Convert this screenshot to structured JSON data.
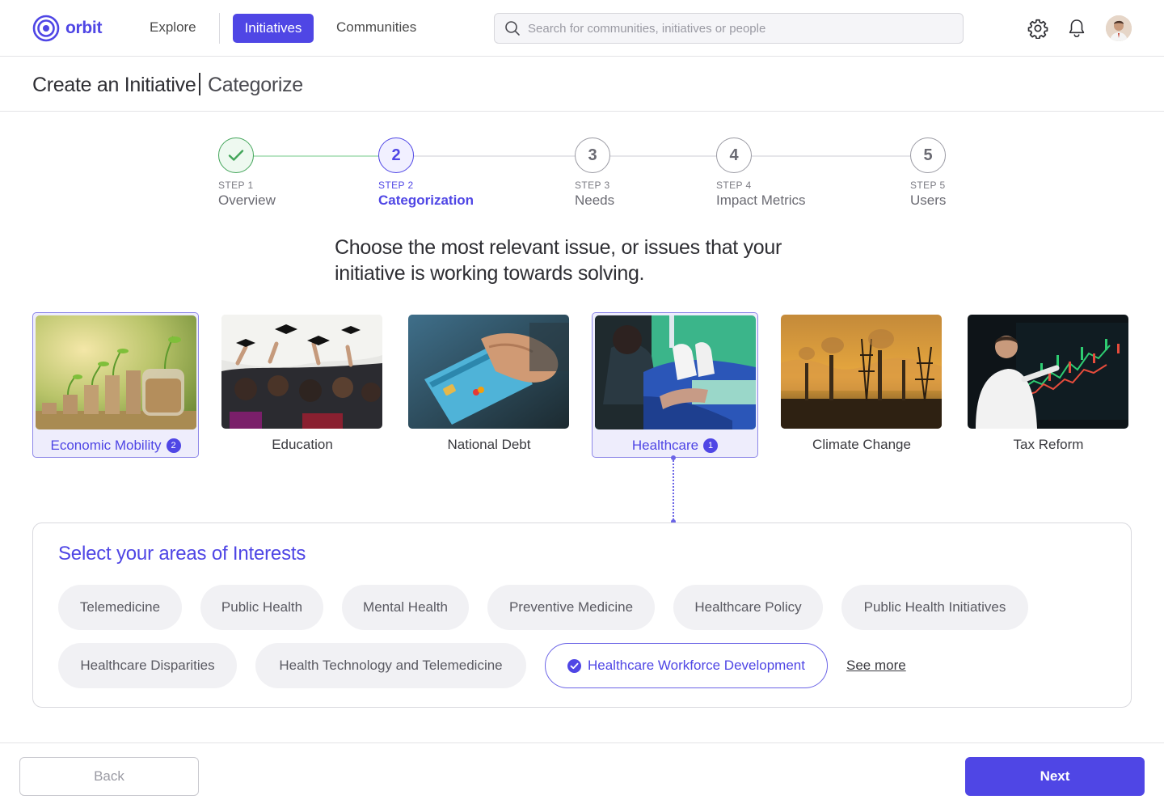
{
  "app": {
    "logo_text": "orbit"
  },
  "nav": {
    "explore": "Explore",
    "initiatives": "Initiatives",
    "communities": "Communities",
    "search_placeholder": "Search for communities, initiatives or people"
  },
  "header": {
    "title": "Create an Initiative",
    "subtitle": "Categorize"
  },
  "steps": [
    {
      "number": "STEP 1",
      "circle": "",
      "name": "Overview",
      "state": "done"
    },
    {
      "number": "STEP 2",
      "circle": "2",
      "name": "Categorization",
      "state": "active"
    },
    {
      "number": "STEP 3",
      "circle": "3",
      "name": "Needs",
      "state": "todo"
    },
    {
      "number": "STEP 4",
      "circle": "4",
      "name": "Impact Metrics",
      "state": "todo"
    },
    {
      "number": "STEP 5",
      "circle": "5",
      "name": "Users",
      "state": "todo"
    }
  ],
  "question": "Choose the most relevant issue, or issues that your initiative is working towards solving.",
  "categories": [
    {
      "label": "Economic Mobility",
      "badge": "2",
      "selected": true
    },
    {
      "label": "Education",
      "badge": "",
      "selected": false
    },
    {
      "label": "National Debt",
      "badge": "",
      "selected": false
    },
    {
      "label": "Healthcare",
      "badge": "1",
      "selected": true
    },
    {
      "label": "Climate Change",
      "badge": "",
      "selected": false
    },
    {
      "label": "Tax Reform",
      "badge": "",
      "selected": false
    }
  ],
  "interests": {
    "title": "Select your areas of Interests",
    "chips": [
      {
        "label": "Telemedicine",
        "selected": false
      },
      {
        "label": "Public Health",
        "selected": false
      },
      {
        "label": "Mental Health",
        "selected": false
      },
      {
        "label": "Preventive Medicine",
        "selected": false
      },
      {
        "label": "Healthcare Policy",
        "selected": false
      },
      {
        "label": "Public Health Initiatives",
        "selected": false
      },
      {
        "label": "Healthcare Disparities",
        "selected": false
      },
      {
        "label": "Health Technology and Telemedicine",
        "selected": false
      },
      {
        "label": "Healthcare Workforce Development",
        "selected": true
      }
    ],
    "see_more": "See more"
  },
  "footer": {
    "back": "Back",
    "next": "Next"
  },
  "colors": {
    "accent": "#4f46e5",
    "success": "#43a55a"
  }
}
